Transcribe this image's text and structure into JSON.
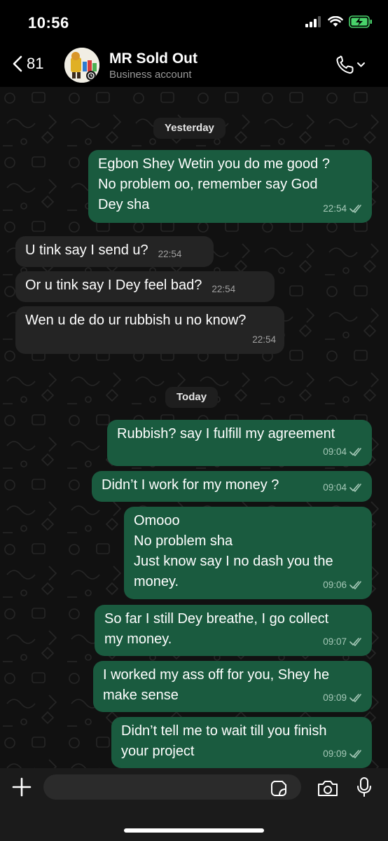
{
  "status_bar": {
    "time": "10:56"
  },
  "header": {
    "back_count": "81",
    "contact_name": "MR Sold Out",
    "contact_subtitle": "Business account"
  },
  "chat": {
    "dividers": {
      "yesterday": "Yesterday",
      "today": "Today"
    },
    "messages": [
      {
        "dir": "out",
        "lines": [
          "Egbon Shey Wetin you do me good ?",
          "No problem oo, remember say God",
          "Dey sha"
        ],
        "time": "22:54",
        "read": true
      },
      {
        "dir": "in",
        "lines": [
          "U tink say I send u?"
        ],
        "time": "22:54"
      },
      {
        "dir": "in",
        "lines": [
          "Or u tink say I Dey feel bad?"
        ],
        "time": "22:54"
      },
      {
        "dir": "in",
        "lines": [
          "Wen u de do ur rubbish u no know?"
        ],
        "time": "22:54"
      },
      {
        "dir": "out",
        "lines": [
          "Rubbish? say I fulfill my agreement"
        ],
        "time": "09:04",
        "read": true
      },
      {
        "dir": "out",
        "lines": [
          "Didn’t I work for my money ?"
        ],
        "time": "09:04",
        "read": true
      },
      {
        "dir": "out",
        "lines": [
          "Omooo",
          "No problem sha",
          "Just know say I no dash you the",
          "money."
        ],
        "time": "09:06",
        "read": true
      },
      {
        "dir": "out",
        "lines": [
          "So far I still Dey breathe, I go collect",
          "my money."
        ],
        "time": "09:07",
        "read": true
      },
      {
        "dir": "out",
        "lines": [
          "I worked my ass off for you, Shey he",
          "make sense"
        ],
        "time": "09:09",
        "read": true
      },
      {
        "dir": "out",
        "lines": [
          "Didn’t tell me to wait till you finish",
          "your project"
        ],
        "time": "09:09",
        "read": true
      }
    ]
  },
  "composer": {
    "input_value": ""
  },
  "colors": {
    "outgoing_bubble": "#1a5b3f",
    "incoming_bubble": "#242424",
    "chat_background": "#111111"
  }
}
